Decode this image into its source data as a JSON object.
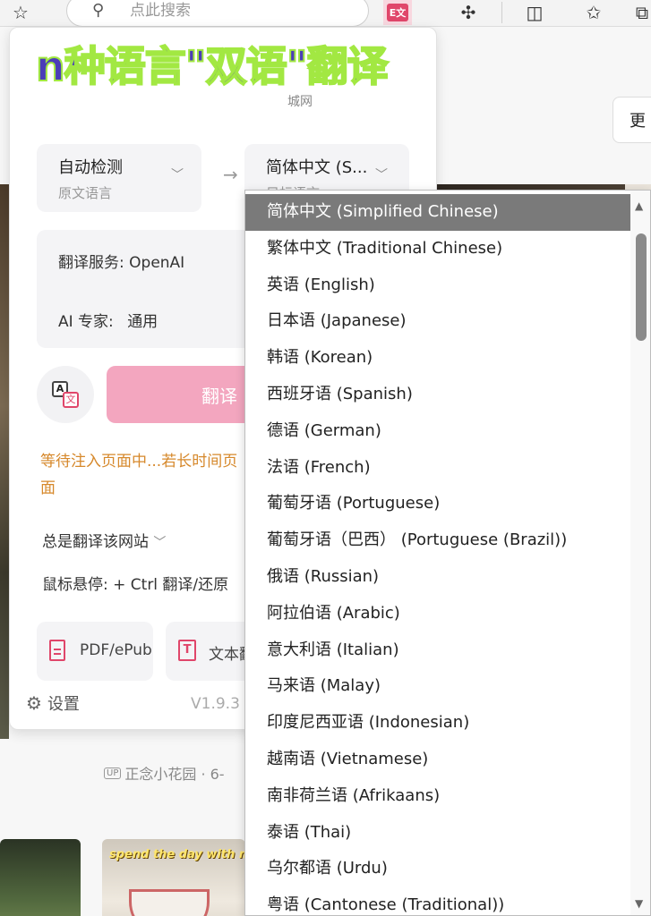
{
  "browser": {
    "search_placeholder": "点此搜索",
    "extension_badge": "E文"
  },
  "background_page": {
    "more_button": "更",
    "uploader": "正念小花园 · 6-",
    "uploader_badge": "UP",
    "thumb_caption": "spend the day with me!",
    "partial_heading": "城网"
  },
  "popup": {
    "promo_banner": "n种语言\"双语\"翻译",
    "source_lang": {
      "value": "自动检测",
      "label": "原文语言"
    },
    "target_lang": {
      "value": "简体中文 (S...",
      "label": "目标语言"
    },
    "service": {
      "label": "翻译服务:",
      "value": "OpenAI"
    },
    "ai_expert": {
      "label": "AI 专家:",
      "value": "通用"
    },
    "translate_button": "翻译",
    "waiting_message": "等待注入页面中...若长时间页面",
    "always_translate": "总是翻译该网站",
    "hover_hint": "鼠标悬停: + Ctrl 翻译/还原",
    "pdf_card": "PDF/ePub",
    "text_card": "文本翻译",
    "settings": "设置",
    "version": "V1.9.3"
  },
  "dropdown": {
    "selected_index": 0,
    "options": [
      "简体中文 (Simplified Chinese)",
      "繁体中文 (Traditional Chinese)",
      "英语 (English)",
      "日本语 (Japanese)",
      "韩语 (Korean)",
      "西班牙语 (Spanish)",
      "德语 (German)",
      "法语 (French)",
      "葡萄牙语 (Portuguese)",
      "葡萄牙语（巴西） (Portuguese (Brazil))",
      "俄语 (Russian)",
      "阿拉伯语 (Arabic)",
      "意大利语 (Italian)",
      "马来语 (Malay)",
      "印度尼西亚语 (Indonesian)",
      "越南语 (Vietnamese)",
      "南非荷兰语 (Afrikaans)",
      "泰语 (Thai)",
      "乌尔都语 (Urdu)",
      "粤语 (Cantonese (Traditional))"
    ]
  },
  "colors": {
    "accent": "#e0466a",
    "translate_button": "#f3a6bf",
    "warning_text": "#d6882b",
    "selected_option": "#7a7a7a"
  }
}
